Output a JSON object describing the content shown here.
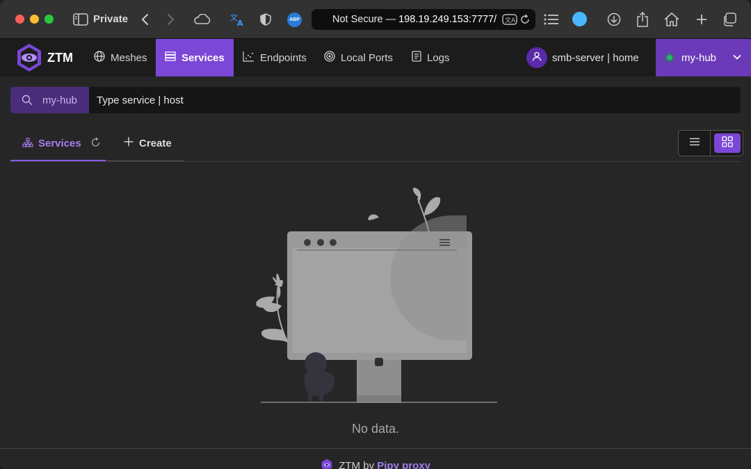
{
  "browser": {
    "private_label": "Private",
    "url_prefix": "Not Secure — ",
    "url_host": "198.19.249.153:7777/",
    "icons": [
      "sidebar-icon",
      "back-icon",
      "forward-icon",
      "icloud-icon",
      "translate-icon",
      "shield-icon",
      "abp-icon",
      "reader-translate-icon",
      "reload-icon",
      "list-icon",
      "extension-icon",
      "download-icon",
      "share-icon",
      "home-icon",
      "new-tab-icon",
      "tabs-overview-icon"
    ],
    "abp_label": "ABP"
  },
  "app": {
    "logo_text": "ZTM",
    "nav": {
      "meshes": "Meshes",
      "services": "Services",
      "endpoints": "Endpoints",
      "local_ports": "Local Ports",
      "logs": "Logs"
    },
    "user_label": "smb-server | home",
    "hub_label": "my-hub",
    "accent": "#7b47d6"
  },
  "search": {
    "prefix_label": "my-hub",
    "placeholder": "Type service | host",
    "value": ""
  },
  "tabs": {
    "services": "Services",
    "create": "Create"
  },
  "empty": {
    "message": "No data."
  },
  "footer": {
    "prefix": "ZTM by ",
    "brand": "Pipy proxy"
  }
}
